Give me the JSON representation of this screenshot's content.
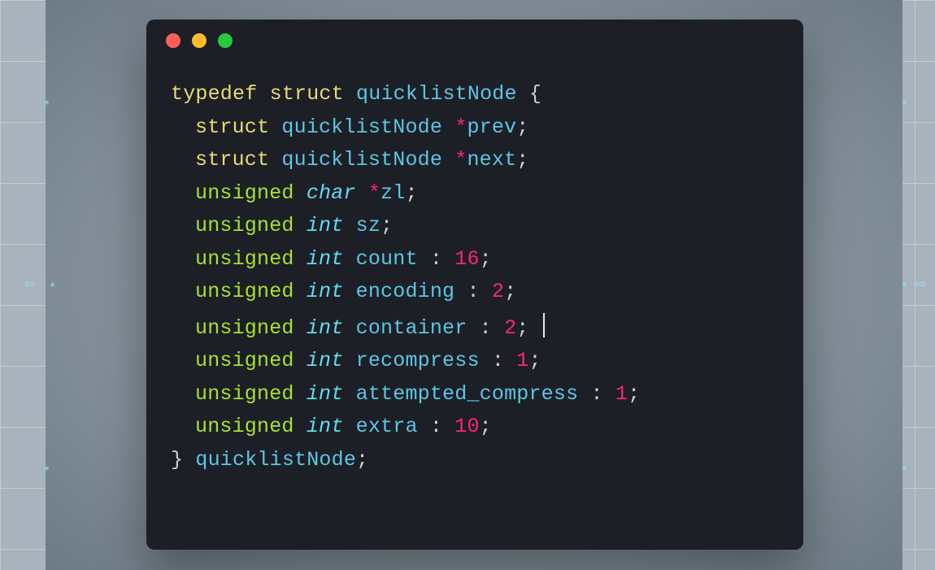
{
  "code": {
    "typedef": "typedef",
    "struct": "struct",
    "unsigned": "unsigned",
    "char": "char",
    "int": "int",
    "structName": "quicklistNode",
    "fields": {
      "prev": "prev",
      "next": "next",
      "zl": "zl",
      "sz": "sz",
      "count": "count",
      "encoding": "encoding",
      "container": "container",
      "recompress": "recompress",
      "attempted_compress": "attempted_compress",
      "extra": "extra"
    },
    "bits": {
      "count": "16",
      "encoding": "2",
      "container": "2",
      "recompress": "1",
      "attempted_compress": "1",
      "extra": "10"
    }
  }
}
